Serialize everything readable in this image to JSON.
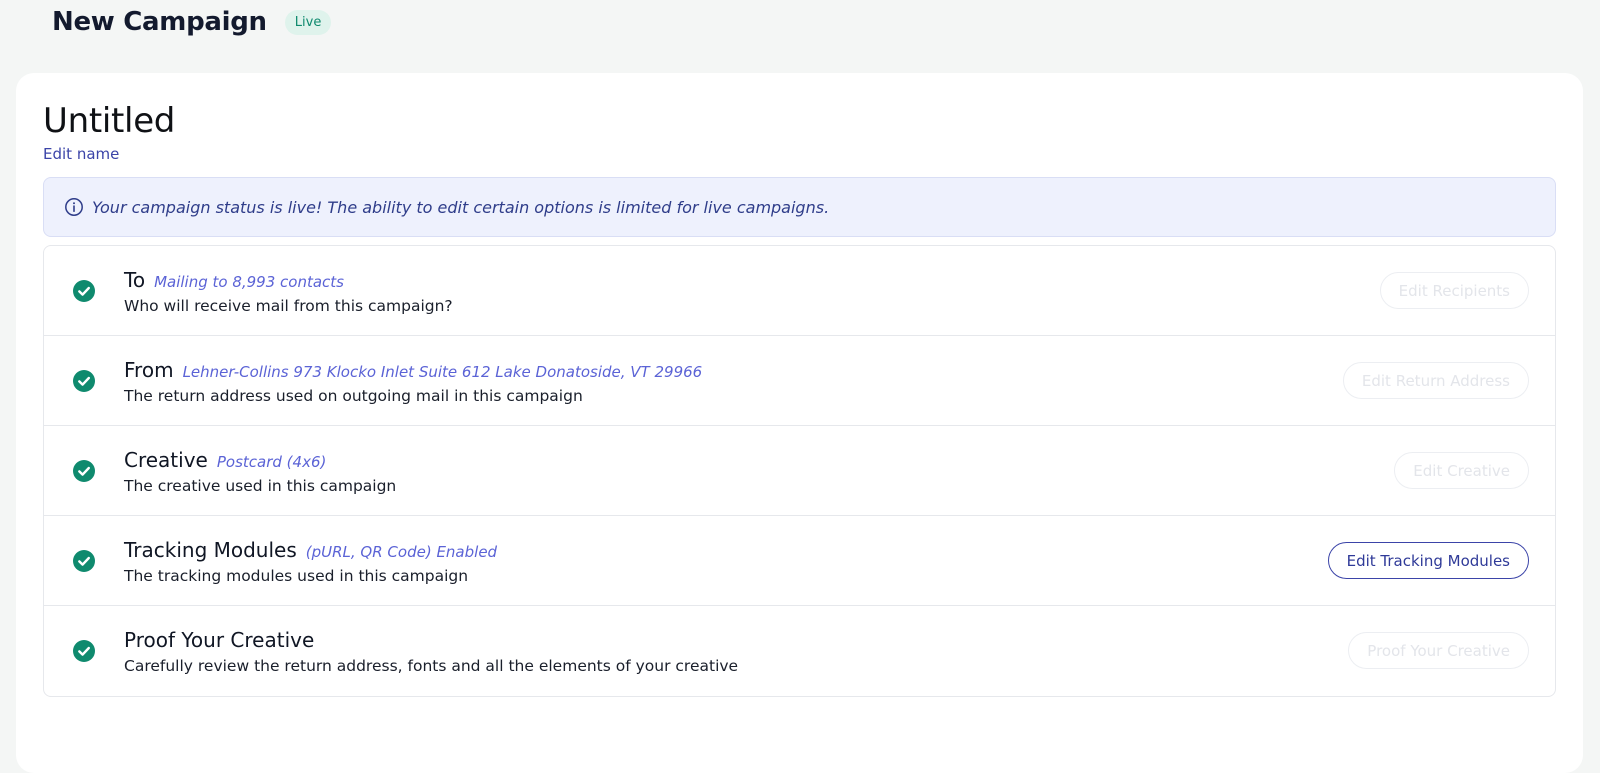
{
  "header": {
    "title": "New Campaign",
    "status_badge": "Live"
  },
  "campaign": {
    "name": "Untitled",
    "edit_name_label": "Edit name"
  },
  "alert": {
    "text": "Your campaign status is live! The ability to edit certain options is limited for live campaigns."
  },
  "steps": [
    {
      "title": "To",
      "meta": "Mailing to 8,993 contacts",
      "description": "Who will receive mail from this campaign?",
      "button": "Edit Recipients",
      "complete": true,
      "button_enabled": false
    },
    {
      "title": "From",
      "meta": "Lehner-Collins 973 Klocko Inlet Suite 612 Lake Donatoside, VT 29966",
      "description": "The return address used on outgoing mail in this campaign",
      "button": "Edit Return Address",
      "complete": true,
      "button_enabled": false
    },
    {
      "title": "Creative",
      "meta": "Postcard (4x6)",
      "description": "The creative used in this campaign",
      "button": "Edit Creative",
      "complete": true,
      "button_enabled": false
    },
    {
      "title": "Tracking Modules",
      "meta": "(pURL, QR Code) Enabled",
      "description": "The tracking modules used in this campaign",
      "button": "Edit Tracking Modules",
      "complete": true,
      "button_enabled": true
    },
    {
      "title": "Proof Your Creative",
      "meta": "",
      "description": "Carefully review the return address, fonts and all the elements of your creative",
      "button": "Proof Your Creative",
      "complete": true,
      "button_enabled": false
    }
  ],
  "colors": {
    "accent": "#3b44a8",
    "success": "#0f8a6e",
    "meta_text": "#5b63d6",
    "alert_bg": "#eef1fd"
  }
}
